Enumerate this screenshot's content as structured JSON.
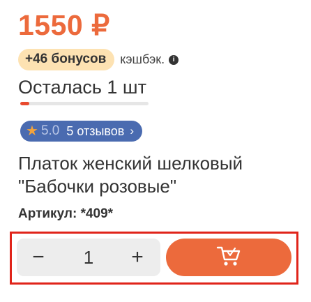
{
  "product": {
    "price": "1550 ₽",
    "bonus": "+46 бонусов",
    "cashback_label": "кэшбэк.",
    "info_icon": "i",
    "stock_text": "Осталась 1 шт",
    "stock_level": 0.07,
    "rating": "5.0",
    "reviews_label": "5 отзывов",
    "reviews_chevron": "›",
    "title": "Платок женский шелковый \"Бабочки розовые\"",
    "sku": "Артикул: *409*"
  },
  "purchase": {
    "minus_label": "−",
    "quantity": "1",
    "plus_label": "+"
  },
  "icons": {
    "star": "star-icon",
    "info": "info-icon",
    "chevron": "chevron-right-icon",
    "cart": "cart-icon"
  },
  "colors": {
    "accent": "#ec6a3c",
    "bonus_bg": "#fde2b2",
    "reviews_bg": "#4a6bb0",
    "stock_fill": "#e94a2e",
    "highlight_frame": "#e0241a"
  }
}
